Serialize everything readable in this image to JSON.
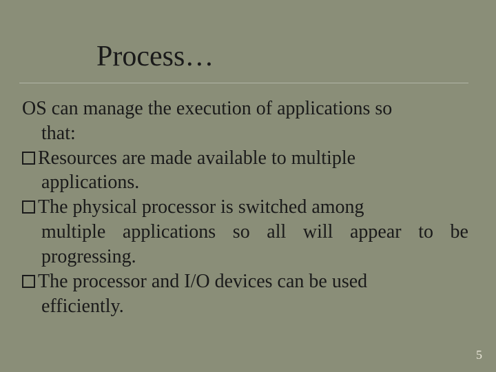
{
  "slide": {
    "title": "Process…",
    "intro_line1": "OS can manage the execution of applications so",
    "intro_line2": "that:",
    "bullets": [
      {
        "first": "Resources are made available to multiple",
        "rest": "applications."
      },
      {
        "first": "The physical processor is switched among",
        "rest": "multiple applications so all will appear to be progressing."
      },
      {
        "first": "The processor and I/O devices can be used",
        "rest": "efficiently."
      }
    ],
    "page_number": "5"
  }
}
